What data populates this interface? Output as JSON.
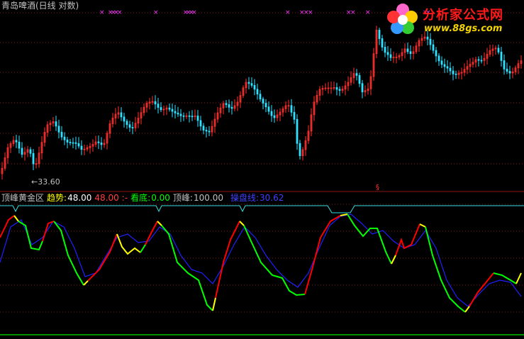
{
  "header": {
    "title": "青岛啤酒(日线 对数)"
  },
  "price_panel": {
    "low_label": "33.60",
    "signal_mark": "§"
  },
  "indicator": {
    "name": "顶峰黄金区",
    "items": [
      {
        "label": "趋势:",
        "value": "48.00",
        "label_color": "#ffff00",
        "value_color": "#ffffff"
      },
      {
        "label": "",
        "value": "48.00",
        "label_color": "#ff4040",
        "value_color": "#ff4040"
      },
      {
        "label": ":-",
        "value": "",
        "label_color": "#ff4040",
        "value_color": "#ff4040"
      },
      {
        "label": "看底:",
        "value": "0.00",
        "label_color": "#00ff00",
        "value_color": "#00ff00"
      },
      {
        "label": "顶峰:",
        "value": "100.00",
        "label_color": "#c0c0c0",
        "value_color": "#c0c0c0"
      },
      {
        "label": "操盘线:",
        "value": "30.62",
        "label_color": "#4040ff",
        "value_color": "#4040ff"
      }
    ]
  },
  "logo": {
    "brand": "分析家公式网",
    "url": "www.88gs.com"
  },
  "colors": {
    "up": "#ff3030",
    "down": "#33e0ff",
    "grid": "#8a1414",
    "marker": "#ff33ff",
    "k_line_red": "#ff0000",
    "k_line_green": "#00ff00",
    "k_line_yellow": "#ffff00",
    "d_line": "#2020ff",
    "top_line": "#33e0e0"
  },
  "icons": [
    "flower-logo-icon",
    "left-arrow-icon"
  ]
}
